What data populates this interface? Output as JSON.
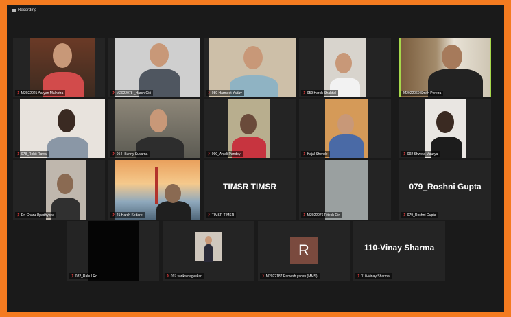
{
  "recording_label": "Recording",
  "participants": [
    {
      "name": "M2022021 Aaryan Malhotra"
    },
    {
      "name": "M2022078 _Harsh Giri"
    },
    {
      "name": "080 Harmeet Yadav"
    },
    {
      "name": "059 Harsh Shahtial"
    },
    {
      "name": "M2022069 Smith Pereira"
    },
    {
      "name": "078_Rohit Rawal"
    },
    {
      "name": "054- Sunny Suvarna"
    },
    {
      "name": "090_Anjali Pandey"
    },
    {
      "name": "Kajal Shende"
    },
    {
      "name": "092 Shweta Maurya"
    },
    {
      "name": "Dr. Charu Upadhyaya"
    },
    {
      "name": "21 Harsh Kedare"
    },
    {
      "name": "TIMSR TIMSR",
      "display": "TIMSR TIMSR"
    },
    {
      "name": "M2022076 Ritesh Giri"
    },
    {
      "name": "079_Roshni Gupta",
      "display": "079_Roshni Gupta"
    },
    {
      "name": "082_Rahul Ro"
    },
    {
      "name": "097 sarika nagvekar"
    },
    {
      "name": "M2022187 Ramesh yadav (MMS)",
      "initial": "R"
    },
    {
      "name": "110-Vinay Sharma",
      "display": "110-Vinay Sharma"
    }
  ]
}
